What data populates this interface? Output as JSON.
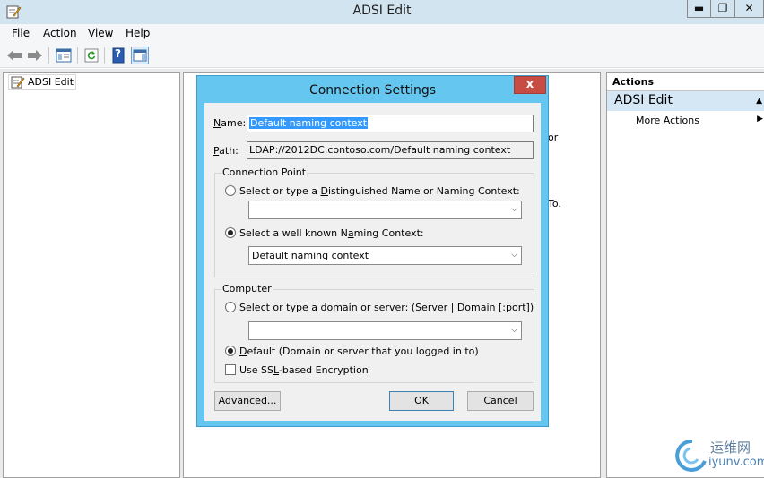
{
  "window": {
    "title": "ADSI Edit",
    "minimize": "▬",
    "maximize": "❐",
    "close": "✕"
  },
  "menu": {
    "file": "File",
    "action": "Action",
    "view": "View",
    "help": "Help"
  },
  "toolbar": {
    "icons": [
      "back-arrow-icon",
      "forward-arrow-icon",
      "console-tree-icon",
      "refresh-icon",
      "help-icon",
      "show-hide-pane-icon"
    ],
    "help_glyph": "?"
  },
  "tree": {
    "root": "ADSI Edit"
  },
  "center_fragments": {
    "line1": "or",
    "line2": "To."
  },
  "actions": {
    "header": "Actions",
    "group": "ADSI Edit",
    "group_arrow": "▲",
    "more": "More Actions",
    "more_arrow": "▶"
  },
  "dialog": {
    "title": "Connection Settings",
    "close": "x",
    "name_label_access": "N",
    "name_label_rest": "ame:",
    "name_value": "Default naming context",
    "path_label_access": "P",
    "path_label_rest": "ath:",
    "path_value": "LDAP://2012DC.contoso.com/Default naming context",
    "connection_point": {
      "title": "Connection Point",
      "dn_option_pre": "Select or type a ",
      "dn_option_access": "D",
      "dn_option_post": "istinguished Name or Naming Context:",
      "dn_value": "",
      "wk_option_pre": "Select a well known N",
      "wk_option_access": "a",
      "wk_option_post": "ming Context:",
      "wk_value": "Default naming context",
      "selected": "well-known"
    },
    "computer": {
      "title": "Computer",
      "server_option_pre": "Select or type a domain or ",
      "server_option_access": "s",
      "server_option_post": "erver: (Server | Domain [:port])",
      "server_value": "",
      "default_option_pre": "D",
      "default_option_access": "e",
      "default_option_post": "fault (Domain or server that you logged in to)",
      "ssl_pre": "Use SS",
      "ssl_access": "L",
      "ssl_post": "-based Encryption",
      "ssl_checked": false,
      "selected": "default"
    },
    "advanced_pre": "Ad",
    "advanced_access": "v",
    "advanced_post": "anced...",
    "ok": "OK",
    "cancel": "Cancel"
  },
  "combo_arrow": "⌵",
  "watermark": {
    "cn": "运维网",
    "en": "iyunv.com"
  },
  "colors": {
    "dialog_frame": "#65c6ef",
    "close_button": "#c74c43",
    "selection": "#3399ff",
    "actions_group": "#d5e6f5"
  }
}
